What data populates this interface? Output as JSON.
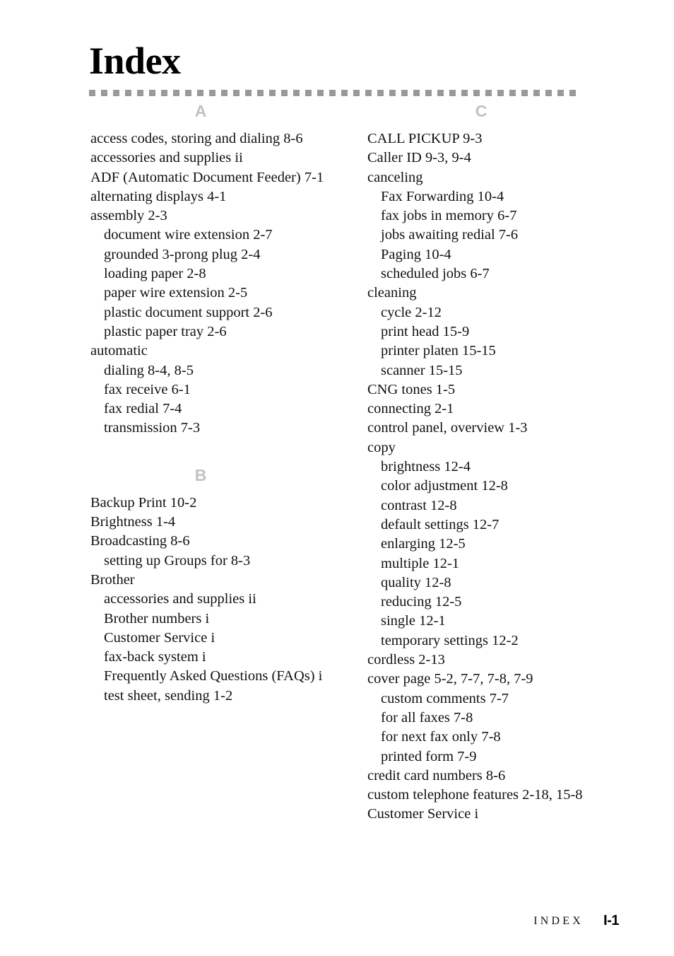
{
  "document": {
    "title": "Index",
    "rule_square_count": 41,
    "rule_color": "#999999",
    "section_letter_color": "#c2c2c2"
  },
  "columns": [
    {
      "name": "left-column",
      "sections": [
        {
          "letter": "A",
          "entries": [
            {
              "level": 1,
              "text": "access codes, storing and dialing 8-6"
            },
            {
              "level": 1,
              "text": "accessories and supplies ii"
            },
            {
              "level": 1,
              "text": "ADF (Automatic Document Feeder) 7-1"
            },
            {
              "level": 1,
              "text": "alternating displays 4-1"
            },
            {
              "level": 1,
              "text": "assembly 2-3"
            },
            {
              "level": 2,
              "text": "document wire extension 2-7"
            },
            {
              "level": 2,
              "text": "grounded 3-prong plug 2-4"
            },
            {
              "level": 2,
              "text": "loading paper 2-8"
            },
            {
              "level": 2,
              "text": "paper wire extension 2-5"
            },
            {
              "level": 2,
              "text": "plastic document support 2-6"
            },
            {
              "level": 2,
              "text": "plastic paper tray 2-6"
            },
            {
              "level": 1,
              "text": "automatic"
            },
            {
              "level": 2,
              "text": "dialing 8-4, 8-5"
            },
            {
              "level": 2,
              "text": "fax receive 6-1"
            },
            {
              "level": 2,
              "text": "fax redial 7-4"
            },
            {
              "level": 2,
              "text": "transmission 7-3"
            }
          ]
        },
        {
          "letter": "B",
          "entries": [
            {
              "level": 1,
              "text": "Backup Print 10-2"
            },
            {
              "level": 1,
              "text": "Brightness 1-4"
            },
            {
              "level": 1,
              "text": "Broadcasting 8-6"
            },
            {
              "level": 2,
              "text": "setting up Groups for 8-3"
            },
            {
              "level": 1,
              "text": "Brother"
            },
            {
              "level": 2,
              "text": "accessories and supplies ii"
            },
            {
              "level": 2,
              "text": "Brother numbers i"
            },
            {
              "level": 2,
              "text": "Customer Service i"
            },
            {
              "level": 2,
              "text": "fax-back system i"
            },
            {
              "level": 2,
              "text": "Frequently Asked Questions (FAQs) i"
            },
            {
              "level": 2,
              "text": "test sheet, sending 1-2"
            }
          ]
        }
      ]
    },
    {
      "name": "right-column",
      "sections": [
        {
          "letter": "C",
          "entries": [
            {
              "level": 1,
              "text": "CALL PICKUP 9-3"
            },
            {
              "level": 1,
              "text": "Caller ID 9-3, 9-4"
            },
            {
              "level": 1,
              "text": "canceling"
            },
            {
              "level": 2,
              "text": "Fax Forwarding 10-4"
            },
            {
              "level": 2,
              "text": "fax jobs in memory 6-7"
            },
            {
              "level": 2,
              "text": "jobs awaiting redial 7-6"
            },
            {
              "level": 2,
              "text": "Paging 10-4"
            },
            {
              "level": 2,
              "text": "scheduled jobs 6-7"
            },
            {
              "level": 1,
              "text": "cleaning"
            },
            {
              "level": 2,
              "text": "cycle 2-12"
            },
            {
              "level": 2,
              "text": "print head 15-9"
            },
            {
              "level": 2,
              "text": "printer platen 15-15"
            },
            {
              "level": 2,
              "text": "scanner 15-15"
            },
            {
              "level": 1,
              "text": "CNG tones 1-5"
            },
            {
              "level": 1,
              "text": "connecting 2-1"
            },
            {
              "level": 1,
              "text": "control panel, overview 1-3"
            },
            {
              "level": 1,
              "text": "copy"
            },
            {
              "level": 2,
              "text": "brightness 12-4"
            },
            {
              "level": 2,
              "text": "color adjustment 12-8"
            },
            {
              "level": 2,
              "text": "contrast 12-8"
            },
            {
              "level": 2,
              "text": "default settings 12-7"
            },
            {
              "level": 2,
              "text": "enlarging 12-5"
            },
            {
              "level": 2,
              "text": "multiple 12-1"
            },
            {
              "level": 2,
              "text": "quality 12-8"
            },
            {
              "level": 2,
              "text": "reducing 12-5"
            },
            {
              "level": 2,
              "text": "single 12-1"
            },
            {
              "level": 2,
              "text": "temporary settings 12-2"
            },
            {
              "level": 1,
              "text": "cordless 2-13"
            },
            {
              "level": 1,
              "text": "cover page 5-2, 7-7, 7-8, 7-9"
            },
            {
              "level": 2,
              "text": "custom comments 7-7"
            },
            {
              "level": 2,
              "text": "for all faxes 7-8"
            },
            {
              "level": 2,
              "text": "for next fax only 7-8"
            },
            {
              "level": 2,
              "text": "printed form 7-9"
            },
            {
              "level": 1,
              "text": "credit card numbers 8-6"
            },
            {
              "level": 1,
              "text": "custom telephone features 2-18, 15-8"
            },
            {
              "level": 1,
              "text": "Customer Service i"
            }
          ]
        }
      ]
    }
  ],
  "footer": {
    "label": "INDEX",
    "page_number": "I-1"
  }
}
